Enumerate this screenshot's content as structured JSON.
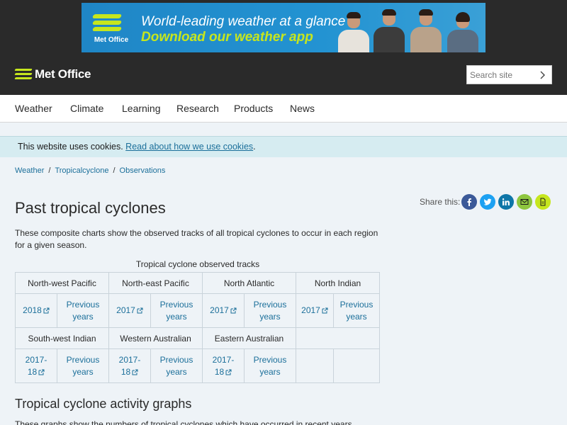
{
  "banner": {
    "brand": "Met Office",
    "line1": "World-leading weather at a glance",
    "line2": "Download our weather app",
    "colors": {
      "background": "#1f86c6",
      "accent": "#c6e61e"
    }
  },
  "header": {
    "logo_text": "Met Office",
    "search_placeholder": "Search site"
  },
  "nav": {
    "items": [
      {
        "label": "Weather"
      },
      {
        "label": "Climate"
      },
      {
        "label": "Learning"
      },
      {
        "label": "Research"
      },
      {
        "label": "Products"
      },
      {
        "label": "News"
      }
    ]
  },
  "cookie": {
    "text": "This website uses cookies.",
    "link": "Read about how we use cookies",
    "period": "."
  },
  "breadcrumb": {
    "items": [
      {
        "label": "Weather"
      },
      {
        "label": "Tropicalcyclone"
      },
      {
        "label": "Observations"
      }
    ],
    "separator": "/"
  },
  "page": {
    "title": "Past tropical cyclones",
    "intro": "These composite charts show the observed tracks of all tropical cyclones to occur in each region for a given season.",
    "share_label": "Share this:",
    "share_icons": [
      "facebook-icon",
      "twitter-icon",
      "linkedin-icon",
      "email-icon",
      "print-icon"
    ]
  },
  "tracks_table": {
    "caption": "Tropical cyclone observed tracks",
    "row1_headers": [
      "North-west Pacific",
      "North-east Pacific",
      "North Atlantic",
      "North Indian"
    ],
    "row1_links": [
      {
        "current": "2018",
        "previous": "Previous years"
      },
      {
        "current": "2017",
        "previous": "Previous years"
      },
      {
        "current": "2017",
        "previous": "Previous years"
      },
      {
        "current": "2017",
        "previous": "Previous years"
      }
    ],
    "row2_headers": [
      "South-west Indian",
      "Western Australian",
      "Eastern Australian",
      ""
    ],
    "row2_links": [
      {
        "current_a": "2017-",
        "current_b": "18",
        "previous": "Previous years"
      },
      {
        "current_a": "2017-",
        "current_b": "18",
        "previous": "Previous years"
      },
      {
        "current_a": "2017-",
        "current_b": "18",
        "previous": "Previous years"
      }
    ]
  },
  "activity": {
    "heading": "Tropical cyclone activity graphs",
    "intro": "These graphs show the numbers of tropical cyclones which have occurred in recent years"
  },
  "colors": {
    "link": "#1b6f9a",
    "header_bg": "#2a2a2a",
    "cookie_bg": "#d6ecf1",
    "page_bg": "#eef3f7"
  }
}
